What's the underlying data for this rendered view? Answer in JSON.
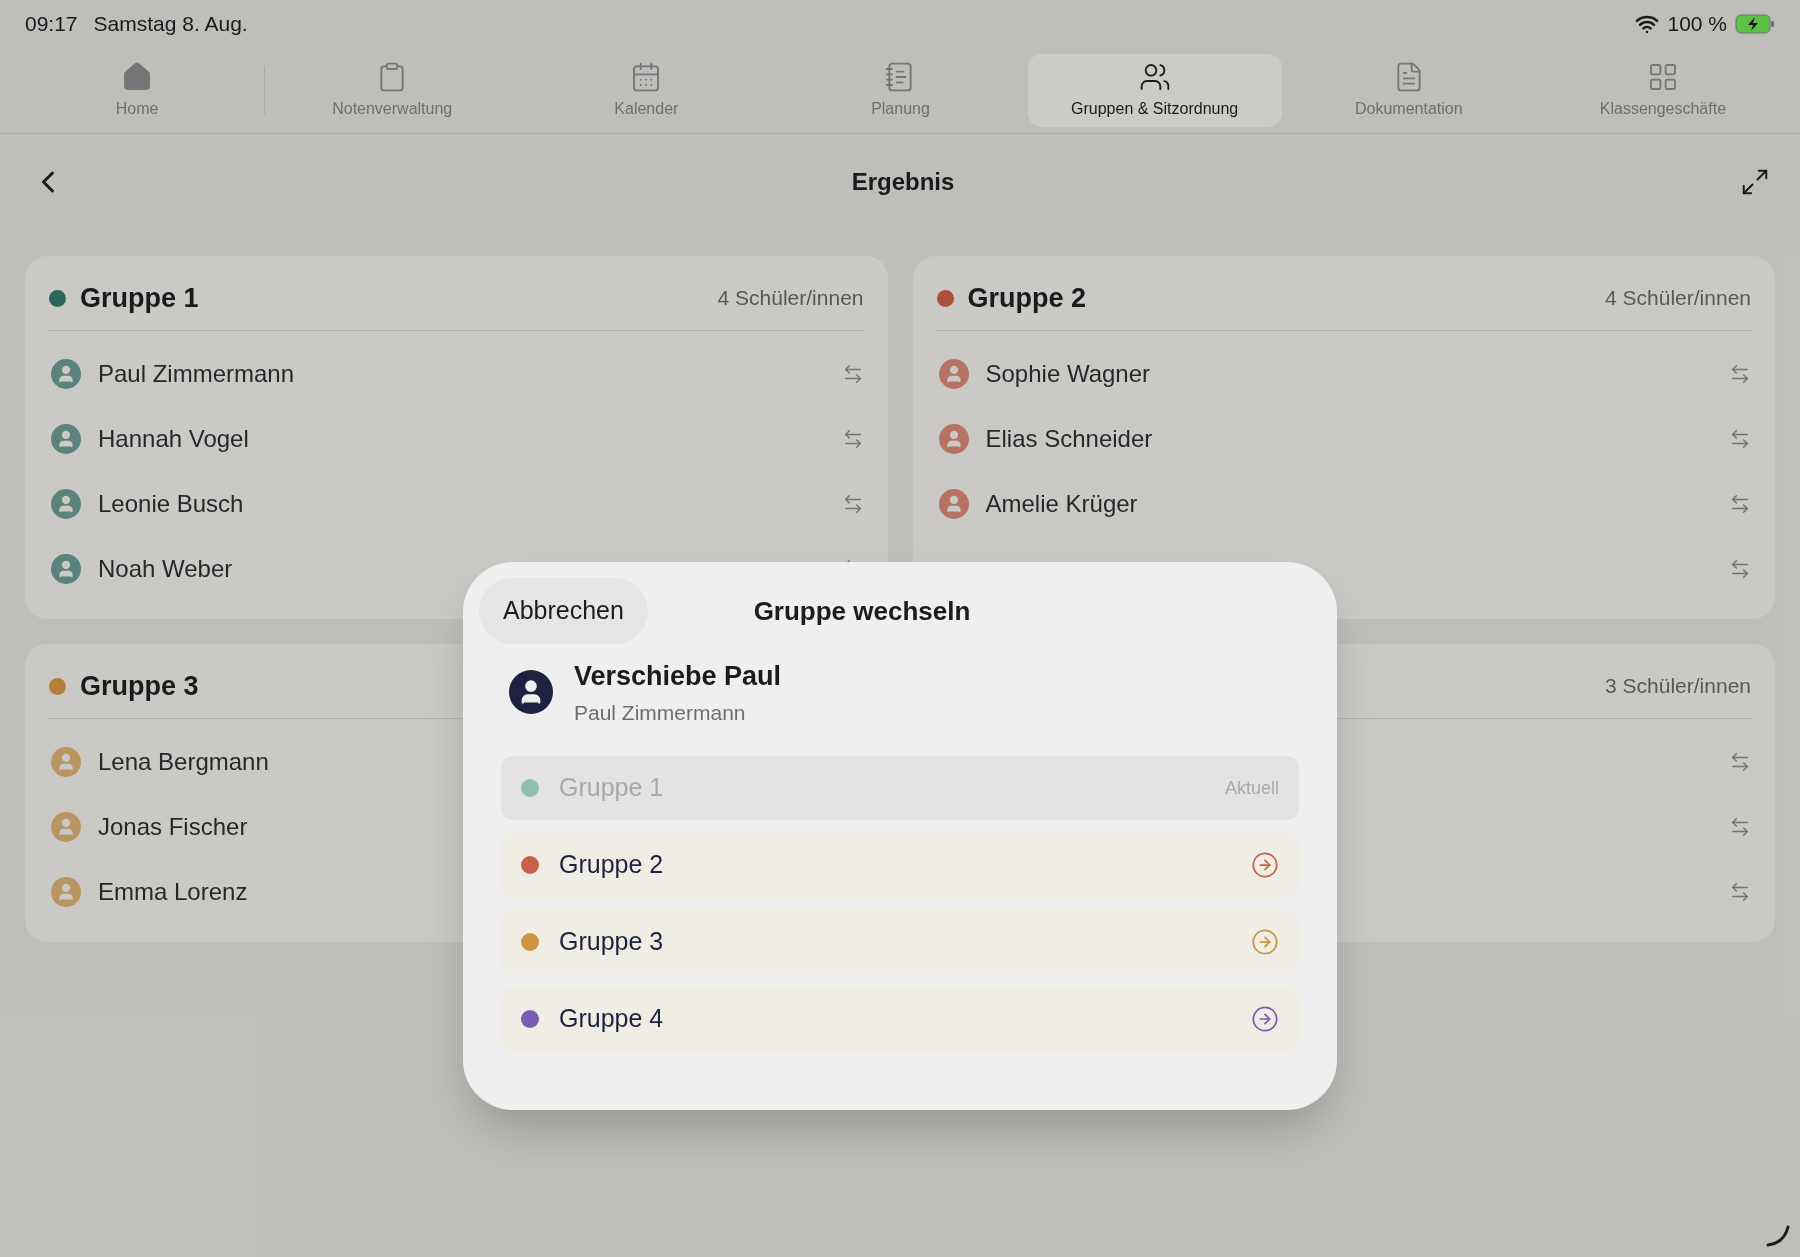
{
  "status_bar": {
    "time": "09:17",
    "date": "Samstag 8. Aug.",
    "battery": "100 %"
  },
  "tabs": [
    {
      "label": "Home",
      "selected": false
    },
    {
      "label": "Notenverwaltung",
      "selected": false
    },
    {
      "label": "Kalender",
      "selected": false
    },
    {
      "label": "Planung",
      "selected": false
    },
    {
      "label": "Gruppen & Sitzordnung",
      "selected": true
    },
    {
      "label": "Dokumentation",
      "selected": false
    },
    {
      "label": "Klassengeschäfte",
      "selected": false
    }
  ],
  "header": {
    "title": "Ergebnis"
  },
  "groups": [
    {
      "title": "Gruppe 1",
      "color": "#2f6b5f",
      "count": "4 Schüler/innen",
      "students": [
        {
          "kind": "visible",
          "name": "Paul Zimmermann"
        },
        {
          "kind": "visible",
          "name": "Hannah Vogel"
        },
        {
          "kind": "visible",
          "name": "Leonie Busch"
        },
        {
          "kind": "visible",
          "name": "Noah Weber"
        }
      ]
    },
    {
      "title": "Gruppe 2",
      "color": "#b4523f",
      "count": "4 Schüler/innen",
      "students": [
        {
          "kind": "visible",
          "name": "Sophie Wagner"
        },
        {
          "kind": "visible",
          "name": "Elias Schneider"
        },
        {
          "kind": "visible",
          "name": "Amelie Krüger"
        },
        {
          "kind": "covered"
        }
      ]
    },
    {
      "title": "Gruppe 3",
      "color": "#b8853a",
      "students": [
        {
          "kind": "name_only",
          "name": "Lena Bergmann"
        },
        {
          "kind": "name_only",
          "name": "Jonas Fischer"
        },
        {
          "kind": "name_only",
          "name": "Emma Lorenz"
        }
      ]
    },
    {
      "count": "3 Schüler/innen",
      "students": [
        {
          "kind": "covered"
        },
        {
          "kind": "covered"
        },
        {
          "kind": "covered"
        }
      ]
    }
  ],
  "dialog": {
    "cancel": "Abbrechen",
    "title": "Gruppe wechseln",
    "heading": "Verschiebe Paul",
    "subtitle": "Paul Zimmermann",
    "options": [
      {
        "label": "Gruppe 1",
        "color": "#8fbfb3",
        "current": true,
        "note": "Aktuell"
      },
      {
        "label": "Gruppe 2",
        "color": "#c9604a",
        "current": false
      },
      {
        "label": "Gruppe 3",
        "color": "#cc9540",
        "current": false
      },
      {
        "label": "Gruppe 4",
        "color": "#7a5cb0",
        "current": false
      }
    ]
  }
}
